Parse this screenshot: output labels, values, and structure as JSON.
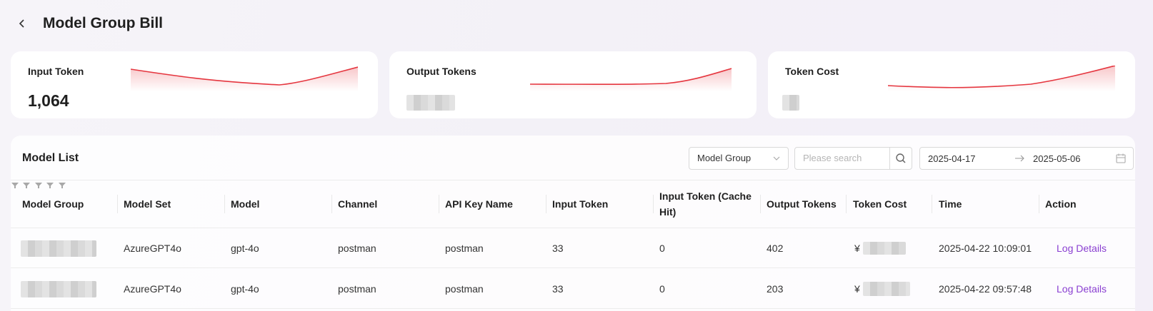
{
  "header": {
    "title": "Model Group Bill"
  },
  "stats": [
    {
      "label": "Input Token",
      "value": "1,064"
    },
    {
      "label": "Output Tokens",
      "value": ""
    },
    {
      "label": "Token Cost",
      "value": ""
    }
  ],
  "list": {
    "title": "Model List",
    "filter_select": "Model Group",
    "search_placeholder": "Please search",
    "date_start": "2025-04-17",
    "date_end": "2025-05-06",
    "columns": [
      "Model Group",
      "Model Set",
      "Model",
      "Channel",
      "API Key Name",
      "Input Token",
      "Input Token (Cache Hit)",
      "Output Tokens",
      "Token Cost",
      "Time",
      "Action"
    ],
    "rows": [
      {
        "model_set": "AzureGPT4o",
        "model": "gpt-4o",
        "channel": "postman",
        "api_key_name": "postman",
        "input_token": "33",
        "cache_hit": "0",
        "output_tokens": "402",
        "cost_symbol": "¥",
        "time": "2025-04-22 10:09:01",
        "action": "Log Details"
      },
      {
        "model_set": "AzureGPT4o",
        "model": "gpt-4o",
        "channel": "postman",
        "api_key_name": "postman",
        "input_token": "33",
        "cache_hit": "0",
        "output_tokens": "203",
        "cost_symbol": "¥",
        "time": "2025-04-22 09:57:48",
        "action": "Log Details"
      }
    ]
  },
  "colors": {
    "accent": "#8a3fd1",
    "spark": "#e5363f"
  }
}
